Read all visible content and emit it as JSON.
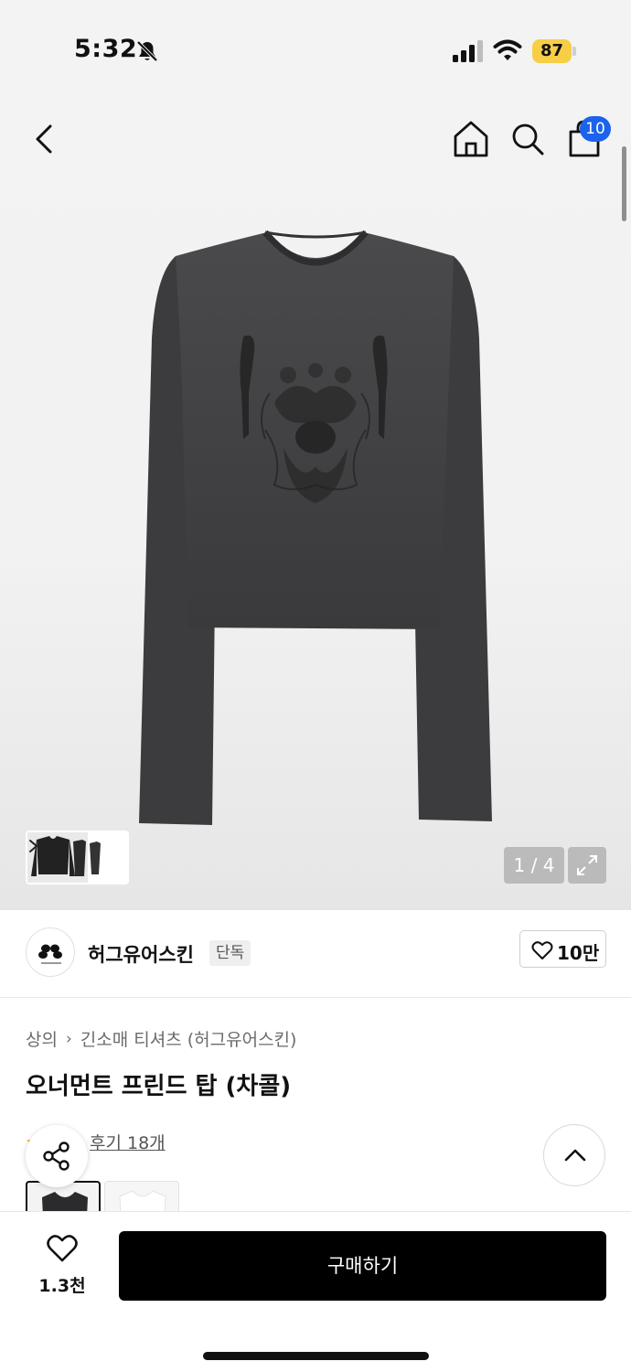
{
  "status_bar": {
    "time": "5:32",
    "battery": "87"
  },
  "header": {
    "cart_count": "10"
  },
  "gallery": {
    "counter": "1 / 4"
  },
  "brand": {
    "name": "허그유어스킨",
    "tag": "단독",
    "likes": "10만",
    "logo_text": "hugyourskin"
  },
  "breadcrumb": {
    "category": "상의",
    "subcategory": "긴소매 티셔츠 (허그유어스킨)"
  },
  "product": {
    "title": "오너먼트 프린드 탑 (차콜)",
    "reviews": "후기 18개"
  },
  "bottom_bar": {
    "like_count": "1.3천",
    "buy_label": "구매하기"
  },
  "colors": {
    "accent_blue": "#1b63ea",
    "battery_yellow": "#f7ce46",
    "buy_button": "#000000"
  }
}
